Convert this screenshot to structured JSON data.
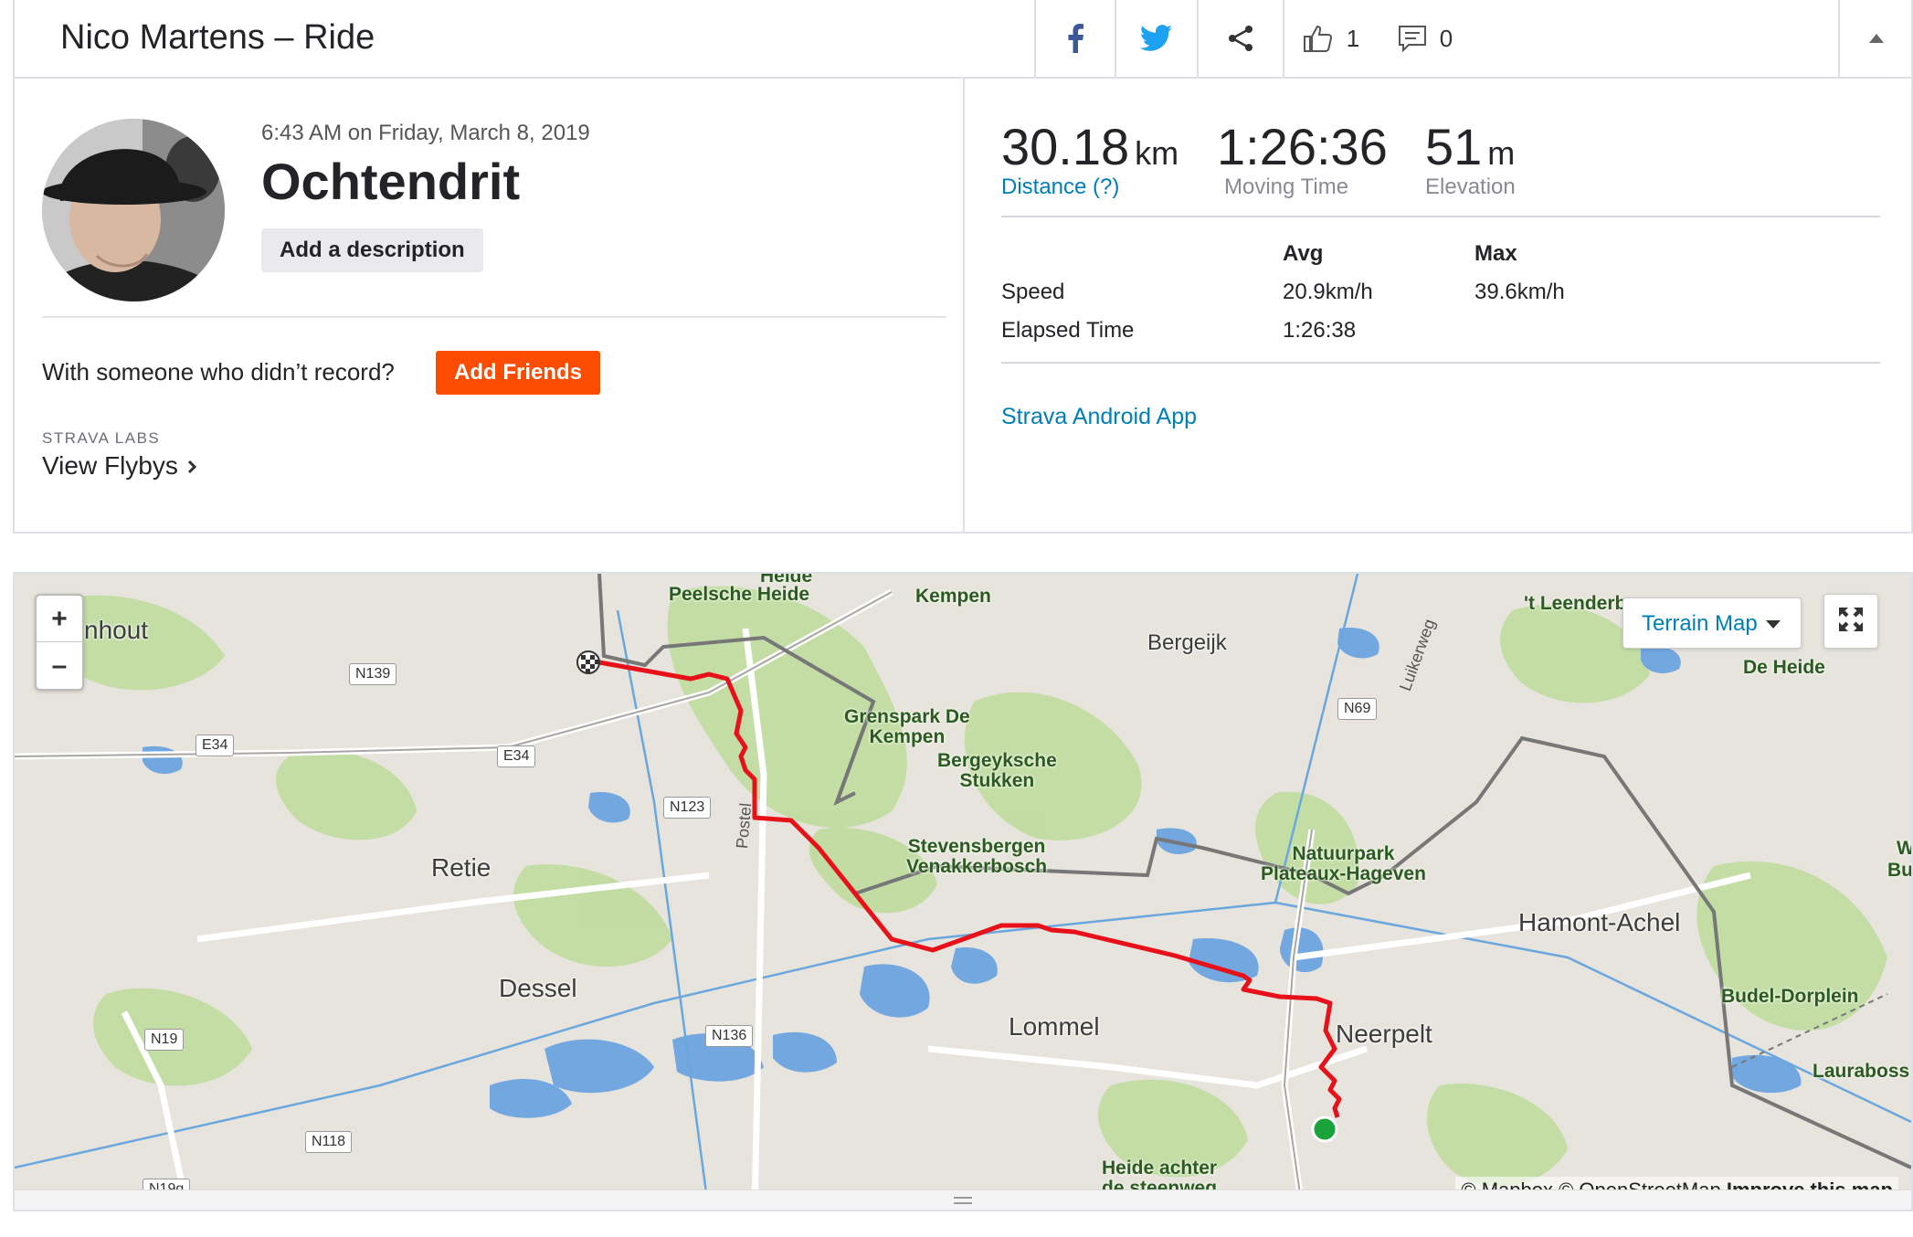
{
  "header": {
    "title": "Nico Martens – Ride",
    "facebook_icon": "facebook-icon",
    "twitter_icon": "twitter-icon",
    "share_icon": "share-icon",
    "kudos_count": "1",
    "comment_count": "0"
  },
  "activity": {
    "date": "6:43 AM on Friday, March 8, 2019",
    "name": "Ochtendrit",
    "add_description_label": "Add a description",
    "with_someone_text": "With someone who didn’t record?",
    "add_friends_label": "Add Friends",
    "labs_label": "STRAVA LABS",
    "flybys_label": "View Flybys"
  },
  "stats": {
    "distance": {
      "value": "30.18",
      "unit": "km",
      "label": "Distance (?)"
    },
    "moving_time": {
      "value": "1:26:36",
      "label": "Moving Time"
    },
    "elevation": {
      "value": "51",
      "unit": "m",
      "label": "Elevation"
    },
    "table": {
      "headers": [
        "Avg",
        "Max"
      ],
      "rows": [
        {
          "label": "Speed",
          "avg": "20.9km/h",
          "max": "39.6km/h"
        },
        {
          "label": "Elapsed Time",
          "avg": "1:26:38",
          "max": ""
        }
      ]
    },
    "device": "Strava Android App"
  },
  "map": {
    "zoom_in": "+",
    "zoom_out": "–",
    "terrain_label": "Terrain Map",
    "towns": [
      "nhout",
      "Bergeijk",
      "Retie",
      "Dessel",
      "Lommel",
      "Neerpelt",
      "Hamont-Achel"
    ],
    "parks": [
      "Heide",
      "Peelsche Heide",
      "Kempen",
      "Grenspark De\nKempen",
      "Bergeyksche\nStukken",
      "Stevensbergen\nVenakkerbosch",
      "Natuurpark\nPlateaux-Hageven",
      "'t Leenderb",
      "De Heide",
      "Budel-Dorplein",
      "Lauraboss",
      "Heide achter\nde steenweg",
      "W",
      "Bu"
    ],
    "roads": [
      "N139",
      "E34",
      "E34",
      "N123",
      "N69",
      "N136",
      "N19",
      "N118",
      "N19g"
    ],
    "street_labels": [
      "Postel",
      "Luikerweg"
    ],
    "attribution_prefix": "© Mapbox © OpenStreetMap",
    "attribution_link": "Improve this map",
    "route_color": "#e8111a",
    "start_color": "#19a33a"
  }
}
